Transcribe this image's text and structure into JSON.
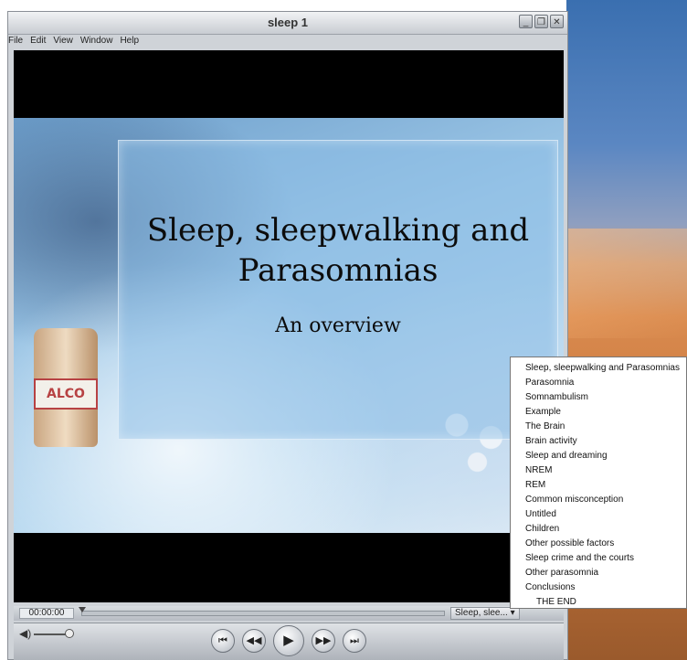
{
  "window": {
    "title": "sleep 1",
    "buttons": {
      "minimize": "_",
      "maximize": "❐",
      "close": "✕"
    }
  },
  "menu": [
    "File",
    "Edit",
    "View",
    "Window",
    "Help"
  ],
  "slide": {
    "title_line1": "Sleep, sleepwalking and",
    "title_line2": "Parasomnias",
    "subtitle": "An overview",
    "bottle_label": "ALCO"
  },
  "playback": {
    "time": "00:00:00",
    "chapter_select": "Sleep, slee... ▾"
  },
  "controls": {
    "volume_icon": "◀)",
    "prev": "⏮",
    "rewind": "◀◀",
    "play": "▶",
    "forward": "▶▶",
    "next": "⏭"
  },
  "chapters": [
    "Sleep, sleepwalking and Parasomnias",
    "Parasomnia",
    "Somnambulism",
    "Example",
    "The Brain",
    "Brain activity",
    "Sleep and dreaming",
    "NREM",
    "REM",
    "Common misconception",
    "Untitled",
    "Children",
    "Other possible factors",
    "Sleep crime and the courts",
    "Other parasomnia",
    "Conclusions",
    "THE END"
  ],
  "colors": {
    "window_chrome": "#cfd3d8",
    "slide_panel": "#8cbee6",
    "video_bg": "#000000"
  }
}
